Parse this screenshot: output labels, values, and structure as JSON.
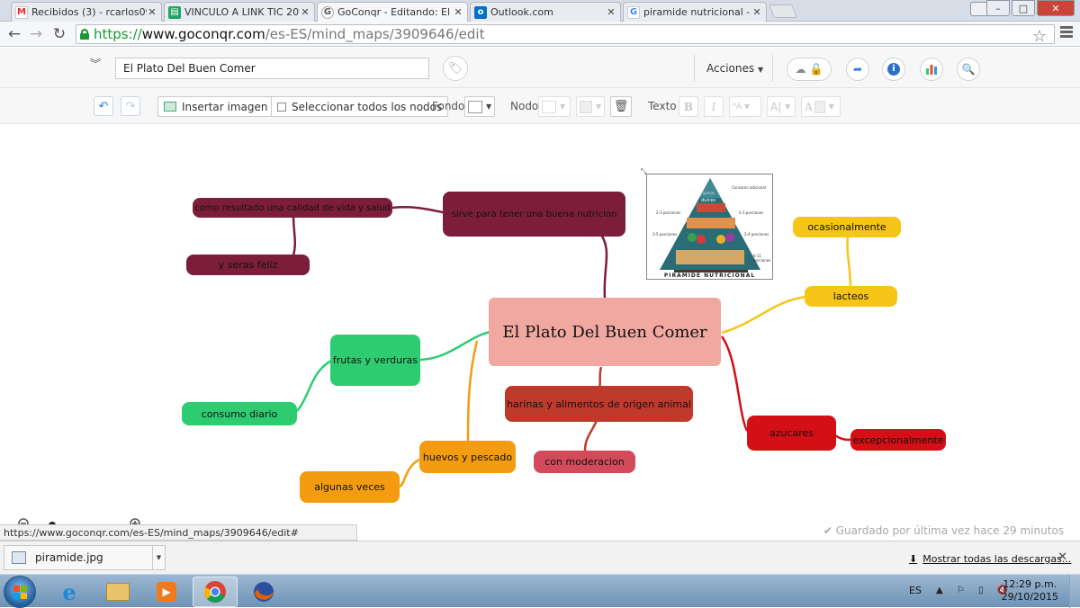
{
  "browser": {
    "tabs": [
      {
        "title": "Recibidos (3) - rcarlos099",
        "icon": "gmail-icon",
        "active": false
      },
      {
        "title": "VINCULO A LINK TIC 2015",
        "icon": "sheets-icon",
        "active": false
      },
      {
        "title": "GoConqr - Editando: El Pl",
        "icon": "goconqr-icon",
        "active": true
      },
      {
        "title": "Outlook.com",
        "icon": "outlook-icon",
        "active": false
      },
      {
        "title": "piramide nutricional - Bus",
        "icon": "google-icon",
        "active": false
      }
    ],
    "url": {
      "scheme": "https://",
      "host": "www.goconqr.com",
      "path": "/es-ES/mind_maps/3909646/edit"
    },
    "status_url": "https://www.goconqr.com/es-ES/mind_maps/3909646/edit#"
  },
  "app_header": {
    "title_value": "El Plato Del Buen Comer",
    "actions_label": "Acciones"
  },
  "toolbar": {
    "insert_image": "Insertar imagen",
    "select_all": "Seleccionar todos los nodos",
    "fondo": "Fondo",
    "nodo": "Nodo",
    "texto": "Texto"
  },
  "mindmap": {
    "root": "El Plato Del Buen Comer",
    "nodes": {
      "sirve": "sirve para tener una buena nutricion",
      "calidad": "como resultado una calidad de vida y salud",
      "feliz": "y seras feliz",
      "frutas": "frutas y verduras",
      "consumo": "consumo diario",
      "harinas": "harinas y alimentos de origen animal",
      "moderacion": "con moderacion",
      "huevos": "huevos y pescado",
      "algunas": "algunas veces",
      "ocasional": "ocasionalmente",
      "lacteos": "lacteos",
      "azucares": "azucares",
      "excepcional": "excepcionalmente"
    },
    "image_caption": "PIRAMIDE NUTRICIONAL",
    "pyramid_labels": {
      "top": "dulces",
      "left1": "2-3 porciones",
      "right1": "2-3 porciones",
      "left2": "3-5 porciones",
      "right2": "2-4 porciones",
      "bottom_right": "6-11 porciones",
      "top_right": "Consumo adicional",
      "top_mid": "grasas"
    }
  },
  "saved_text": "Guardado por última vez hace 29 minutos",
  "downloads": {
    "file": "piramide.jpg",
    "show_all": "Mostrar todas las descargas..."
  },
  "taskbar": {
    "lang": "ES",
    "time": "12:29 p.m.",
    "date": "29/10/2015"
  },
  "colors": {
    "maroon": "#7c1e3b",
    "green": "#2ecc71",
    "orange": "#f39c12",
    "yellow": "#f5c518",
    "red": "#d40f15",
    "root": "#f0a8a0"
  }
}
